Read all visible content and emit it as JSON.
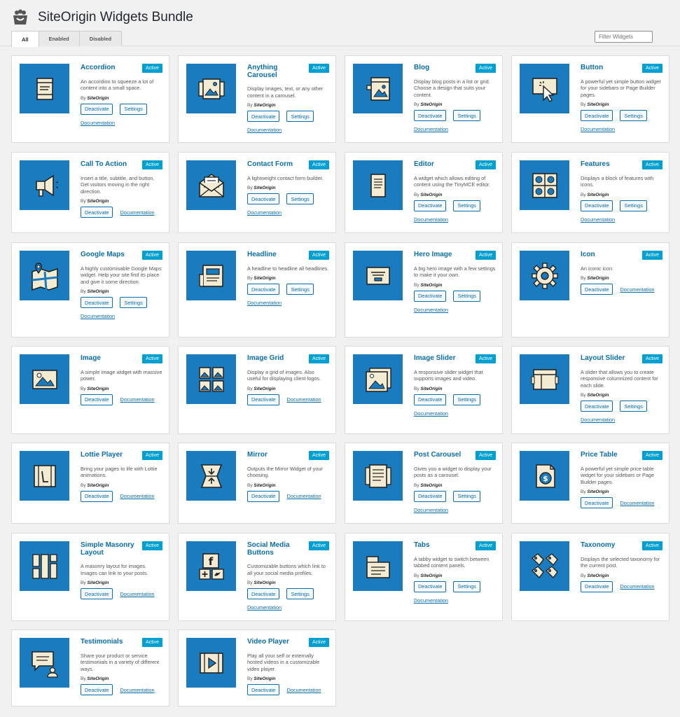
{
  "header": {
    "title": "SiteOrigin Widgets Bundle"
  },
  "tabs": [
    {
      "label": "All",
      "active": true
    },
    {
      "label": "Enabled",
      "active": false
    },
    {
      "label": "Disabled",
      "active": false
    }
  ],
  "filter": {
    "placeholder": "Filter Widgets"
  },
  "labels": {
    "active": "Active",
    "deactivate": "Deactivate",
    "settings": "Settings",
    "documentation": "Documentation",
    "by": "By",
    "author": "SiteOrigin"
  },
  "colors": {
    "icon_bg": "#1b7bbf",
    "badge_bg": "#00a0d2",
    "link": "#0a6ea8"
  },
  "widgets": [
    {
      "name": "Accordion",
      "icon": "accordion-icon",
      "desc": "An accordion to squeeze a lot of content into a small space.",
      "settings": true
    },
    {
      "name": "Anything Carousel",
      "icon": "carousel-icon",
      "desc": "Display images, text, or any other content in a carousel.",
      "settings": true
    },
    {
      "name": "Blog",
      "icon": "blog-icon",
      "desc": "Display blog posts in a list or grid. Choose a design that suits your content.",
      "settings": true
    },
    {
      "name": "Button",
      "icon": "button-icon",
      "desc": "A powerful yet simple button widget for your sidebars or Page Builder pages.",
      "settings": true
    },
    {
      "name": "Call To Action",
      "icon": "megaphone-icon",
      "desc": "Insert a title, subtitle, and button. Get visitors moving in the right direction.",
      "settings": false
    },
    {
      "name": "Contact Form",
      "icon": "envelope-icon",
      "desc": "A lightweight contact form builder.",
      "settings": true
    },
    {
      "name": "Editor",
      "icon": "editor-icon",
      "desc": "A widget which allows editing of content using the TinyMCE editor.",
      "settings": true
    },
    {
      "name": "Features",
      "icon": "features-icon",
      "desc": "Displays a block of features with icons.",
      "settings": true
    },
    {
      "name": "Google Maps",
      "icon": "map-icon",
      "desc": "A highly customisable Google Maps widget. Help your site find its place and give it some direction.",
      "settings": true
    },
    {
      "name": "Headline",
      "icon": "headline-icon",
      "desc": "A headline to headline all headlines.",
      "settings": true
    },
    {
      "name": "Hero Image",
      "icon": "hero-icon",
      "desc": "A big hero image with a few settings to make it your own.",
      "settings": true
    },
    {
      "name": "Icon",
      "icon": "gear-icon",
      "desc": "An iconic icon.",
      "settings": false
    },
    {
      "name": "Image",
      "icon": "image-icon",
      "desc": "A simple image widget with massive power.",
      "settings": false
    },
    {
      "name": "Image Grid",
      "icon": "image-grid-icon",
      "desc": "Display a grid of images. Also useful for displaying client logos.",
      "settings": false
    },
    {
      "name": "Image Slider",
      "icon": "image-slider-icon",
      "desc": "A responsive slider widget that supports images and video.",
      "settings": true
    },
    {
      "name": "Layout Slider",
      "icon": "layout-slider-icon",
      "desc": "A slider that allows you to create responsive columnized content for each slide.",
      "settings": true
    },
    {
      "name": "Lottie Player",
      "icon": "lottie-icon",
      "desc": "Bring your pages to life with Lottie animations.",
      "settings": false
    },
    {
      "name": "Mirror",
      "icon": "mirror-icon",
      "desc": "Outputs the Mirror Widget of your choosing.",
      "settings": false
    },
    {
      "name": "Post Carousel",
      "icon": "post-carousel-icon",
      "desc": "Gives you a widget to display your posts as a carousel.",
      "settings": true
    },
    {
      "name": "Price Table",
      "icon": "price-table-icon",
      "desc": "A powerful yet simple price table widget for your sidebars or Page Builder pages.",
      "settings": false
    },
    {
      "name": "Simple Masonry Layout",
      "icon": "masonry-icon",
      "desc": "A masonry layout for images. Images can link to your posts.",
      "settings": false
    },
    {
      "name": "Social Media Buttons",
      "icon": "social-icon",
      "desc": "Customizable buttons which link to all your social media profiles.",
      "settings": true
    },
    {
      "name": "Tabs",
      "icon": "tabs-icon",
      "desc": "A tabby widget to switch between tabbed content panels.",
      "settings": true
    },
    {
      "name": "Taxonomy",
      "icon": "taxonomy-icon",
      "desc": "Displays the selected taxonomy for the current post.",
      "settings": false
    },
    {
      "name": "Testimonials",
      "icon": "testimonials-icon",
      "desc": "Share your product or service testimonials in a variety of different ways.",
      "settings": false
    },
    {
      "name": "Video Player",
      "icon": "video-icon",
      "desc": "Play all your self or externally hosted videos in a customizable video player.",
      "settings": false
    }
  ]
}
